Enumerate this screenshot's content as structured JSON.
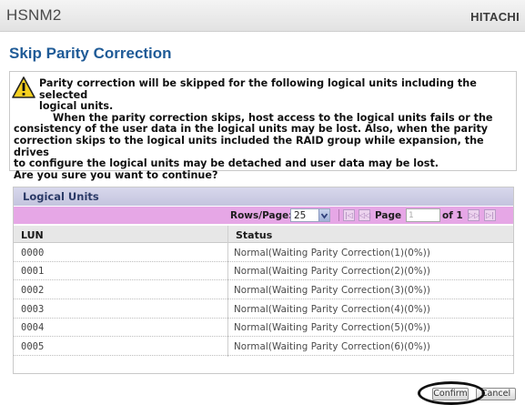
{
  "app": {
    "name": "HSNM2",
    "brand": "HITACHI"
  },
  "page": {
    "title": "Skip Parity Correction"
  },
  "warning": {
    "icon": "warning-icon",
    "line1": "Parity correction will be skipped for the following logical units including the selected",
    "line2": "logical units.",
    "line3": "When the parity correction skips, host access to the logical units fails or the",
    "line4": "consistency of the user data in the logical units may be lost. Also, when the parity",
    "line5": "correction skips to the logical units included the RAID group while expansion, the drives",
    "line6": "to configure the logical units may be detached and user data may be lost.",
    "line7": "Are you sure you want to continue?"
  },
  "logical_units": {
    "title": "Logical Units",
    "pager": {
      "rows_label": "Rows/Page:",
      "rows_value": "25",
      "page_label": "Page",
      "page_value": "1",
      "of_label": "of 1"
    },
    "columns": {
      "lun": "LUN",
      "status": "Status"
    },
    "rows": [
      {
        "lun": "0000",
        "status": "Normal(Waiting Parity Correction(1)(0%))"
      },
      {
        "lun": "0001",
        "status": "Normal(Waiting Parity Correction(2)(0%))"
      },
      {
        "lun": "0002",
        "status": "Normal(Waiting Parity Correction(3)(0%))"
      },
      {
        "lun": "0003",
        "status": "Normal(Waiting Parity Correction(4)(0%))"
      },
      {
        "lun": "0004",
        "status": "Normal(Waiting Parity Correction(5)(0%))"
      },
      {
        "lun": "0005",
        "status": "Normal(Waiting Parity Correction(6)(0%))"
      }
    ]
  },
  "buttons": {
    "confirm": "Confirm",
    "cancel": "Cancel"
  },
  "colors": {
    "title_blue": "#1f5b97",
    "pager_pink": "#e6a7e6",
    "header_lavender": "#c4c4de"
  }
}
